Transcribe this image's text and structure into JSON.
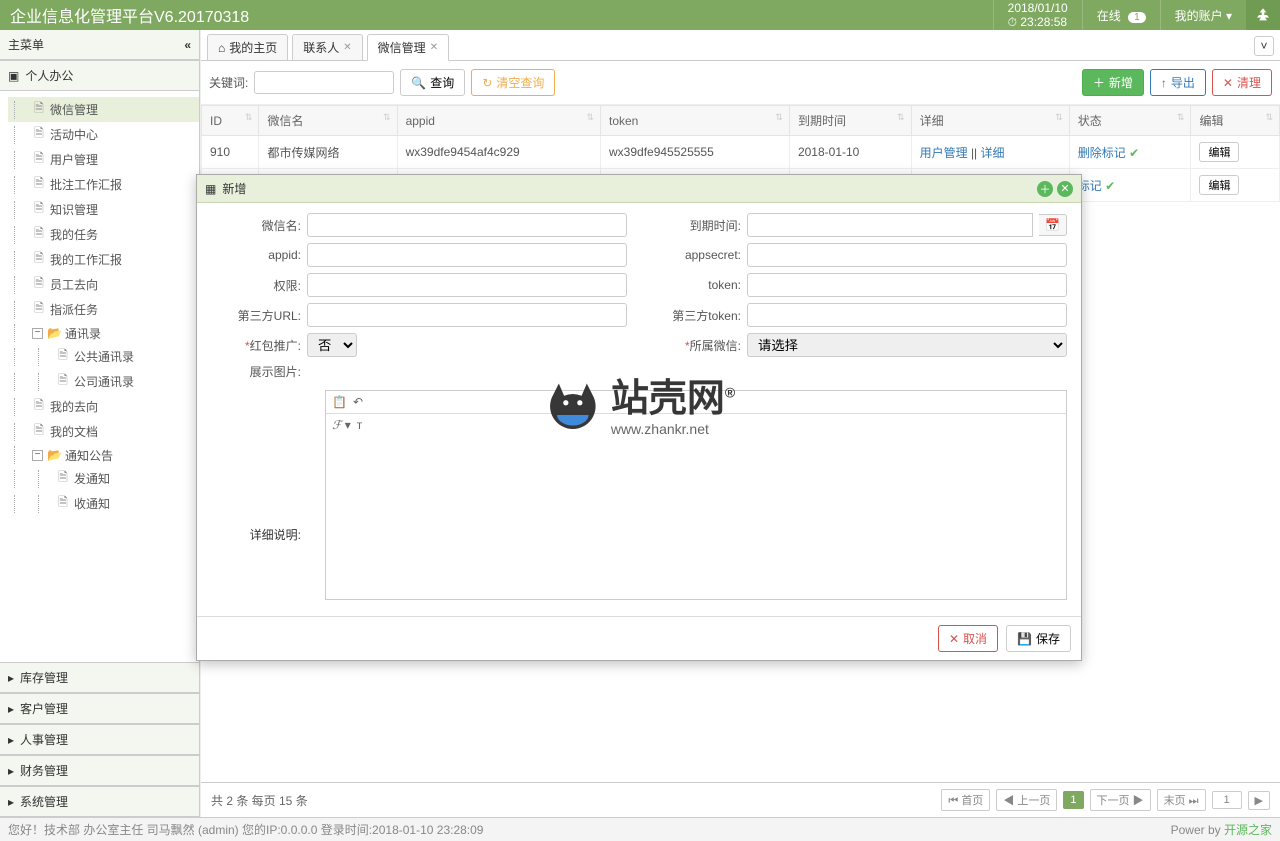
{
  "header": {
    "title": "企业信息化管理平台V6.20170318",
    "date": "2018/01/10",
    "time": "23:28:58",
    "online_label": "在线",
    "online_count": "1",
    "account_label": "我的账户"
  },
  "sidebar": {
    "title": "主菜单",
    "main_section": "个人办公",
    "tree": [
      {
        "label": "微信管理",
        "active": true,
        "depth": 1,
        "icon": "file"
      },
      {
        "label": "活动中心",
        "depth": 1,
        "icon": "file"
      },
      {
        "label": "用户管理",
        "depth": 1,
        "icon": "file"
      },
      {
        "label": "批注工作汇报",
        "depth": 1,
        "icon": "file"
      },
      {
        "label": "知识管理",
        "depth": 1,
        "icon": "file"
      },
      {
        "label": "我的任务",
        "depth": 1,
        "icon": "file"
      },
      {
        "label": "我的工作汇报",
        "depth": 1,
        "icon": "file"
      },
      {
        "label": "员工去向",
        "depth": 1,
        "icon": "file"
      },
      {
        "label": "指派任务",
        "depth": 1,
        "icon": "file"
      },
      {
        "label": "通讯录",
        "depth": 1,
        "icon": "folder",
        "expander": "−"
      },
      {
        "label": "公共通讯录",
        "depth": 2,
        "icon": "file"
      },
      {
        "label": "公司通讯录",
        "depth": 2,
        "icon": "file"
      },
      {
        "label": "我的去向",
        "depth": 1,
        "icon": "file"
      },
      {
        "label": "我的文档",
        "depth": 1,
        "icon": "file"
      },
      {
        "label": "通知公告",
        "depth": 1,
        "icon": "folder",
        "expander": "−"
      },
      {
        "label": "发通知",
        "depth": 2,
        "icon": "file"
      },
      {
        "label": "收通知",
        "depth": 2,
        "icon": "file"
      }
    ],
    "collapsed_sections": [
      "库存管理",
      "客户管理",
      "人事管理",
      "财务管理",
      "系统管理"
    ]
  },
  "tabs": [
    {
      "label": "我的主页",
      "home": true
    },
    {
      "label": "联系人",
      "closable": true
    },
    {
      "label": "微信管理",
      "closable": true,
      "active": true
    }
  ],
  "toolbar": {
    "kw_label": "关键词:",
    "search": "查询",
    "clear": "清空查询",
    "add": "新增",
    "export": "导出",
    "clean": "清理"
  },
  "grid": {
    "cols": [
      "ID",
      "微信名",
      "appid",
      "token",
      "到期时间",
      "详细",
      "状态",
      "编辑"
    ],
    "rows": [
      {
        "id": "910",
        "name": "都市传媒网络",
        "appid": "wx39dfe9454af4c929",
        "token": "wx39dfe945525555",
        "expire": "2018-01-10",
        "detail_a": "用户管理",
        "detail_b": "详细",
        "status": "删除标记",
        "edit": "编辑"
      },
      {
        "id": "",
        "name": "",
        "appid": "",
        "token": "",
        "expire": "",
        "detail_a": "",
        "detail_b": "",
        "status": "标记",
        "edit": "编辑"
      }
    ]
  },
  "pager": {
    "summary": "共 2 条 每页 15 条",
    "first": "首页",
    "prev": "上一页",
    "page": "1",
    "next": "下一页",
    "last": "末页",
    "goto": "1"
  },
  "footer": {
    "left": "您好！技术部 办公室主任 司马飘然 (admin) 您的IP:0.0.0.0 登录时间:2018-01-10 23:28:09",
    "right_prefix": "Power by ",
    "right_link": "开源之家"
  },
  "modal": {
    "title": "新增",
    "labels": {
      "wxname": "微信名:",
      "expire": "到期时间:",
      "appid": "appid:",
      "appsecret": "appsecret:",
      "perm": "权限:",
      "token": "token:",
      "url": "第三方URL:",
      "tptoken": "第三方token:",
      "hongbao": "红包推广:",
      "belong": "所属微信:",
      "image": "展示图片:",
      "desc": "详细说明:"
    },
    "hongbao_val": "否",
    "belong_placeholder": "请选择",
    "cancel": "取消",
    "save": "保存"
  },
  "watermark": {
    "main": "站壳网",
    "sub": "www.zhankr.net",
    "reg": "®"
  }
}
